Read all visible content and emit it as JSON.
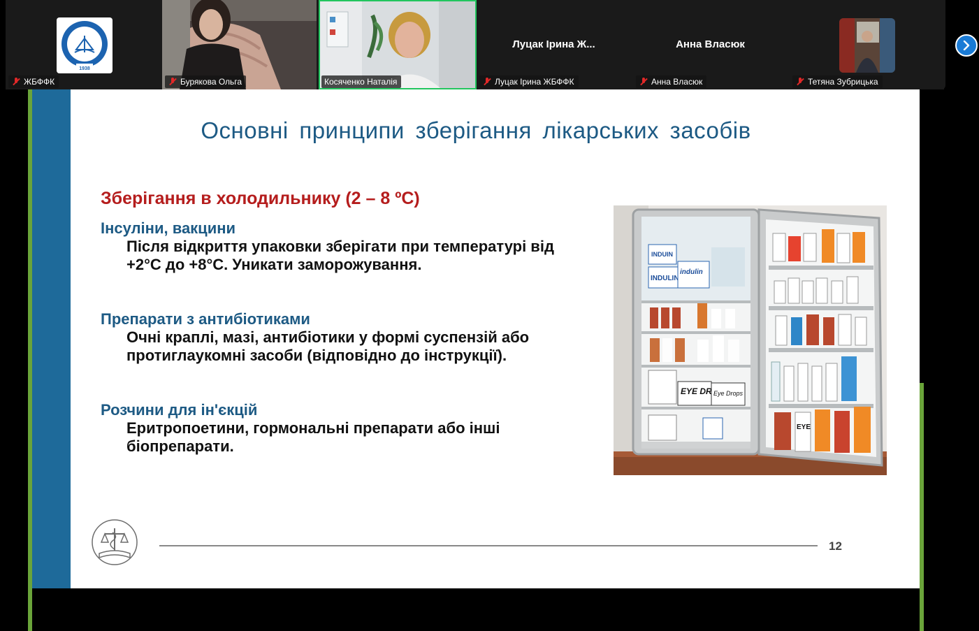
{
  "participants": [
    {
      "name": "ЖБФФК",
      "muted": true,
      "type": "logo",
      "logo_year": "1938"
    },
    {
      "name": "Бурякова Ольга",
      "muted": true,
      "type": "video"
    },
    {
      "name": "Косяченко Наталія",
      "muted": false,
      "type": "video",
      "active_speaker": true
    },
    {
      "name": "Луцак Ірина ЖБФФК",
      "display_name": "Луцак Ірина Ж...",
      "muted": true,
      "type": "name"
    },
    {
      "name": "Анна Власюк",
      "display_name": "Анна Власюк",
      "muted": true,
      "type": "name"
    },
    {
      "name": "Тетяна Зубрицька",
      "muted": true,
      "type": "avatar"
    }
  ],
  "next_page_icon": "chevron-right-icon",
  "slide": {
    "title": "Основні принципи зберігання лікарських засобів",
    "heading": "Зберігання в холодильнику (2 – 8 ºC)",
    "sections": [
      {
        "subheading": "Інсуліни, вакцини",
        "lines": [
          "Після відкриття упаковки зберігати при температурі від",
          "+2°С до +8°С. Уникати заморожування."
        ]
      },
      {
        "subheading": "Препарати з антибіотиками",
        "lines": [
          "Очні краплі, мазі, антибіотики у формі суспензій або",
          "протиглаукомні засоби (відповідно до інструкції)."
        ]
      },
      {
        "subheading": "Розчини для ін'єкцій",
        "lines": [
          "Еритропоетини, гормональні препарати або інші",
          "біопрепарати."
        ]
      }
    ],
    "page_number": "12",
    "image_labels": [
      "INDUIN",
      "INDULIN",
      "indulin",
      "EYE DROPS",
      "Eye Drops",
      "EYE"
    ]
  },
  "colors": {
    "title": "#1d5a84",
    "heading": "#b51d1d",
    "band": "#1e6a9a",
    "accent_green": "#6aa43a",
    "active_border": "#22c55e",
    "mic_muted": "#e02828"
  }
}
